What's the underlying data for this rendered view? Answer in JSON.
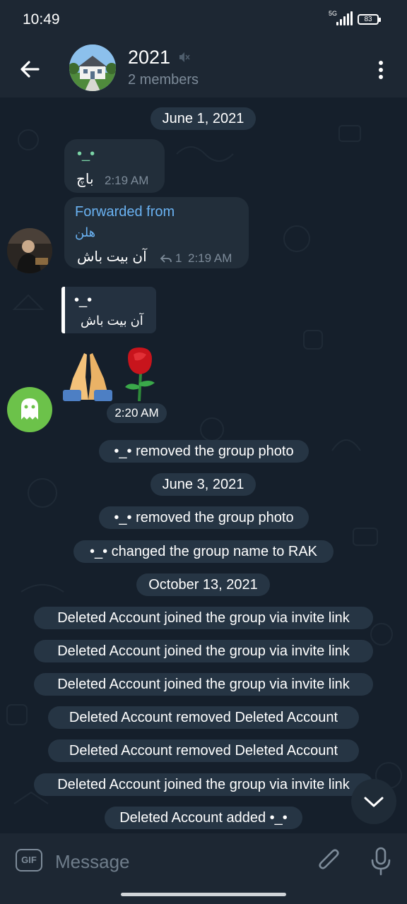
{
  "status_bar": {
    "time": "10:49",
    "network": "5G",
    "battery": "83"
  },
  "header": {
    "title": "2021",
    "subtitle": "2 members"
  },
  "messages": {
    "date1": "June 1, 2021",
    "msg1_text": "•_•",
    "msg1_text2": "باچ",
    "msg1_time": "2:19 AM",
    "fwd_label": "Forwarded from",
    "fwd_name": "هلن",
    "fwd_text": "آن بیت باش",
    "fwd_reply_count": "1",
    "fwd_time": "2:19 AM",
    "quote_name": "•_•",
    "quote_text": "آن بیت باش",
    "emoji_time": "2:20 AM"
  },
  "service": {
    "s1": "•_• removed the group photo",
    "date2": "June 3, 2021",
    "s2": "•_• removed the group photo",
    "s3": "•_• changed the group name to RAK",
    "date3": "October 13, 2021",
    "s4": "Deleted Account joined the group via invite link",
    "s5": "Deleted Account joined the group via invite link",
    "s6": "Deleted Account joined the group via invite link",
    "s7": "Deleted Account removed Deleted Account",
    "s8": "Deleted Account removed Deleted Account",
    "s9": "Deleted Account joined the group via invite link",
    "s10": "Deleted Account added •_•"
  },
  "input": {
    "placeholder": "Message",
    "gif_label": "GIF"
  },
  "colors": {
    "accent": "#6ab2f2",
    "bubble": "#222e3a",
    "header": "#1d2733",
    "ghost_avatar": "#6cc24a"
  }
}
